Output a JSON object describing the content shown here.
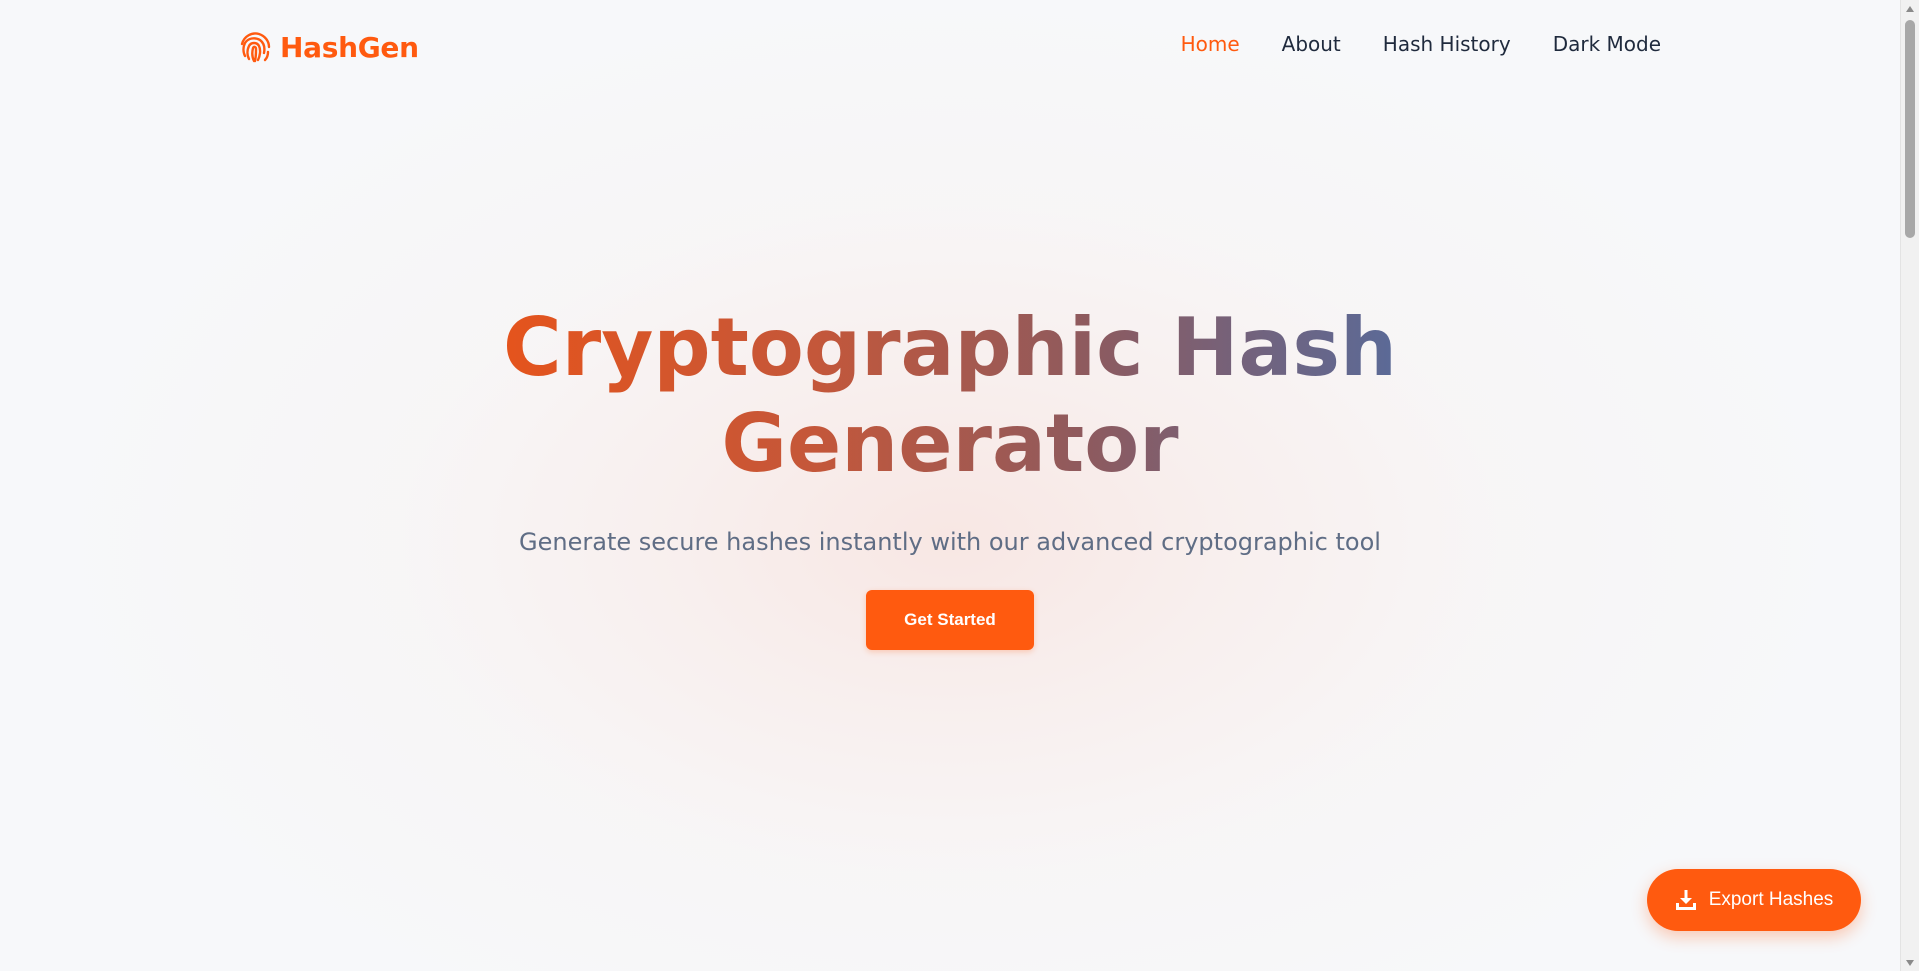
{
  "brand": {
    "name": "HashGen",
    "icon": "fingerprint-icon",
    "color": "#ff5a0f"
  },
  "nav": {
    "items": [
      {
        "label": "Home",
        "active": true
      },
      {
        "label": "About",
        "active": false
      },
      {
        "label": "Hash History",
        "active": false
      },
      {
        "label": "Dark Mode",
        "active": false
      }
    ]
  },
  "hero": {
    "title_line1": "Cryptographic Hash",
    "title_line2": "Generator",
    "subtitle": "Generate secure hashes instantly with our advanced cryptographic tool",
    "cta_label": "Get Started"
  },
  "export": {
    "label": "Export Hashes",
    "icon": "download-icon"
  },
  "colors": {
    "accent": "#ff5a0f",
    "text_dark": "#1f2a3d",
    "subtitle": "#5f6d85",
    "title_gradient_start": "#e5541c",
    "title_gradient_end": "#5a6a98"
  }
}
